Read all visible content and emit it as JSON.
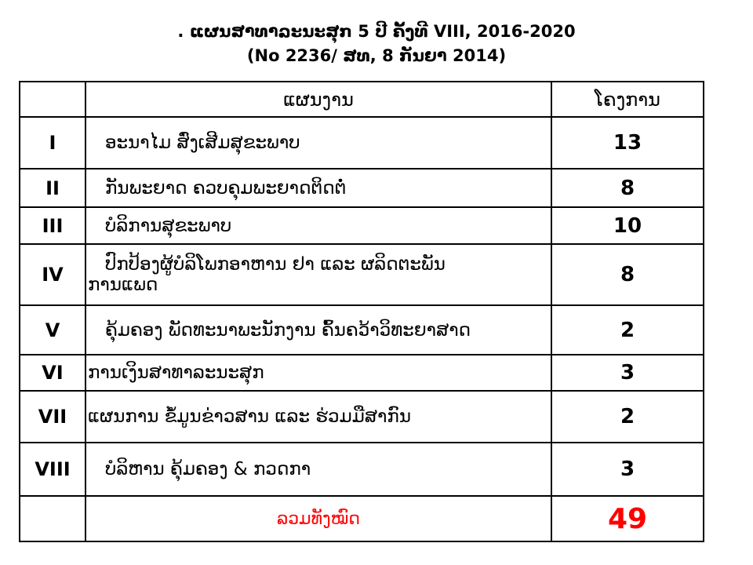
{
  "title": {
    "line1": ". ແຜນສາທາລະນະສຸກ 5 ປີ ຄັ້ງທີ VIII, 2016-2020",
    "line2": "(No 2236/ ສທ, 8 ກັນຍາ 2014)"
  },
  "table": {
    "headers": {
      "number": "",
      "plan": "ແຜນງານ",
      "projects": "ໂຄງການ"
    },
    "rows": [
      {
        "number": "I",
        "name": "ອະນາໄມ ສົ່ງເສີມສຸຂະພາບ",
        "projects": "13"
      },
      {
        "number": "II",
        "name": "ກັນພະຍາດ ຄວບຄຸມພະຍາດຕິດຕໍ່",
        "projects": "8"
      },
      {
        "number": "III",
        "name": "ບໍລິການສຸຂະພາບ",
        "projects": "10"
      },
      {
        "number": "IV",
        "name_line1": "ປົກປ້ອງຜູ້ບໍລິໂພກອາຫານ ຢາ ແລະ ຜລິດຕະພັນ",
        "name_line2": "ການແພດ",
        "projects": "8"
      },
      {
        "number": "V",
        "name": "ຄຸ້ມຄອງ ພັດທະນາພະນັກງານ ຄົ້ນຄວ້າວິທະຍາສາດ",
        "projects": "2"
      },
      {
        "number": "VI",
        "name": "ການເງິນສາທາລະນະສຸກ",
        "projects": "3"
      },
      {
        "number": "VII",
        "name": "ແຜນການ ຂໍ້ມູນຂ່າວສານ ແລະ ຮ່ວມມືສາກົນ",
        "projects": "2"
      },
      {
        "number": "VIII",
        "name": "ບໍລິຫານ ຄຸ້ມຄອງ & ກວດກາ",
        "projects": "3"
      }
    ],
    "total": {
      "label": "ລວມທັງໝົດ",
      "value": "49"
    }
  },
  "colors": {
    "text": "#000000",
    "total": "#ff0000",
    "border": "#000000",
    "background": "#ffffff"
  }
}
